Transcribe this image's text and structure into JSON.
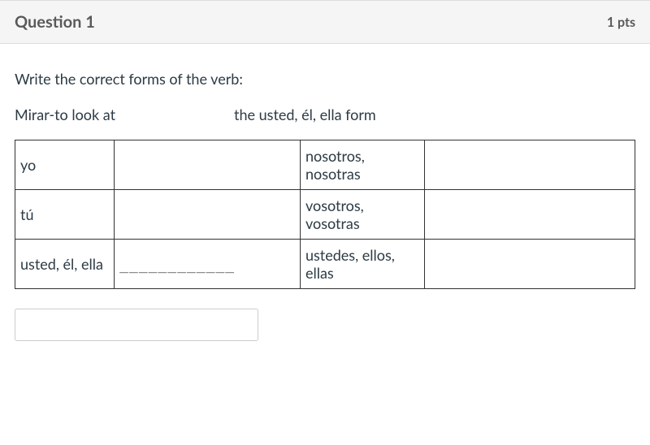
{
  "header": {
    "title": "Question 1",
    "points": "1 pts"
  },
  "prompt": {
    "instruction": "Write the correct forms of the verb:",
    "verb_info": "Mirar-to look at",
    "form_info": "the usted, él, ella  form"
  },
  "table": {
    "rows": [
      {
        "left_pronoun": "yo",
        "left_answer": "",
        "right_pronoun": "nosotros, nosotras",
        "right_answer": ""
      },
      {
        "left_pronoun": "tú",
        "left_answer": "",
        "right_pronoun": "vosotros, vosotras",
        "right_answer": ""
      },
      {
        "left_pronoun": "usted, él, ella",
        "left_answer": "____________",
        "right_pronoun": "ustedes, ellos, ellas",
        "right_answer": ""
      }
    ]
  },
  "input": {
    "value": "",
    "placeholder": ""
  }
}
